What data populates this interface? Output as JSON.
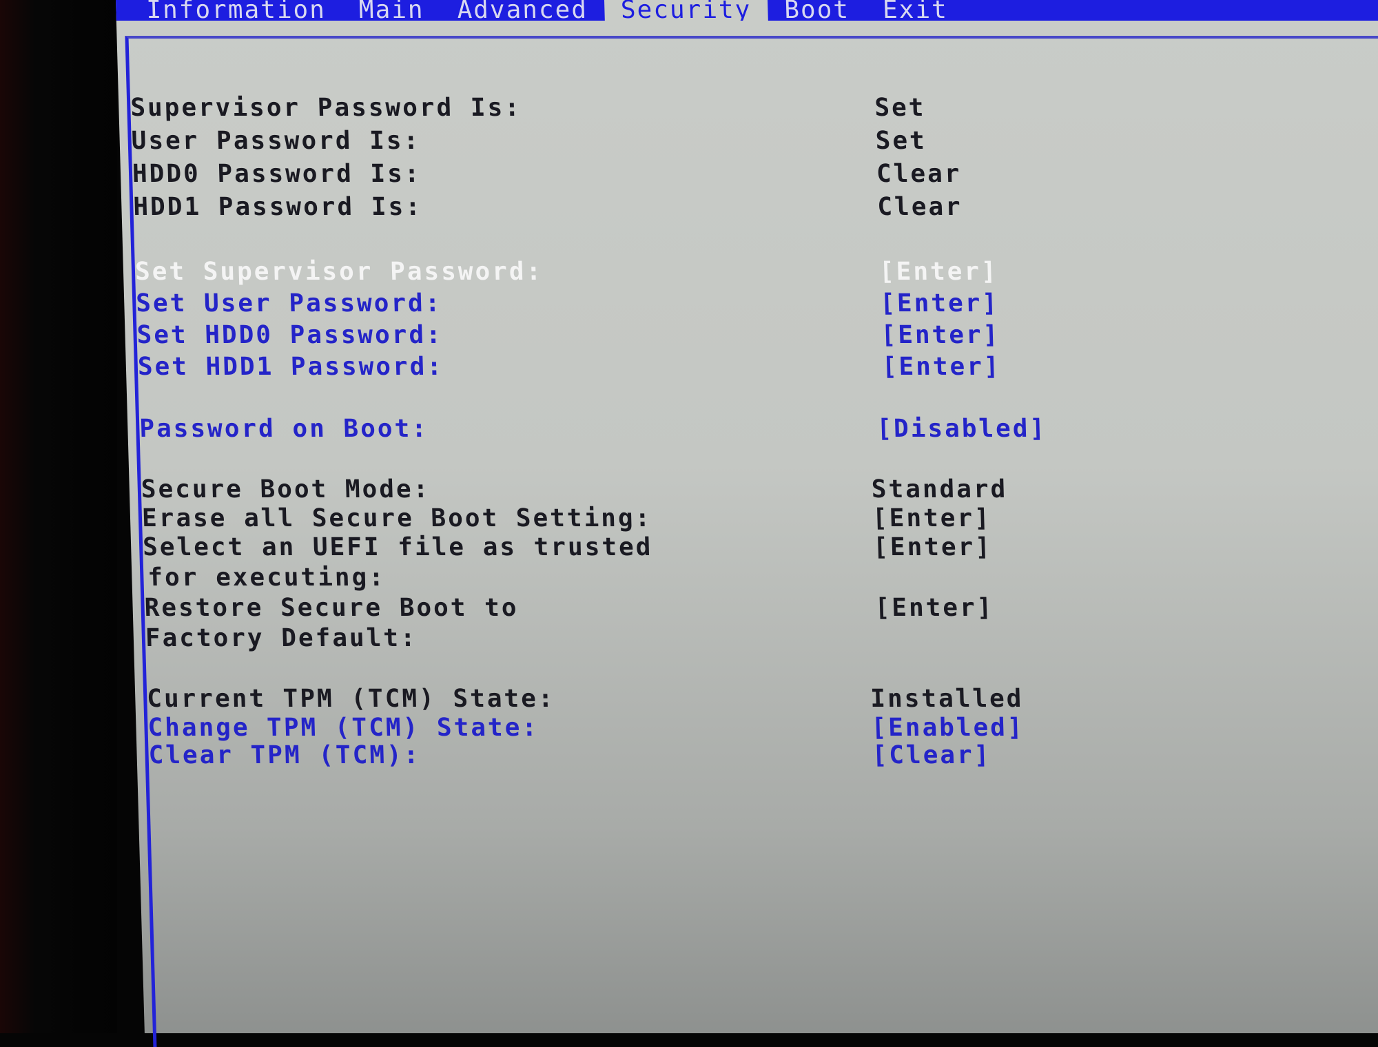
{
  "menu": {
    "tabs": [
      {
        "label": "Information",
        "active": false
      },
      {
        "label": "Main",
        "active": false
      },
      {
        "label": "Advanced",
        "active": false
      },
      {
        "label": "Security",
        "active": true
      },
      {
        "label": "Boot",
        "active": false
      },
      {
        "label": "Exit",
        "active": false
      }
    ]
  },
  "security": {
    "status": [
      {
        "label": "Supervisor Password Is:",
        "value": "Set"
      },
      {
        "label": "User Password Is:",
        "value": "Set"
      },
      {
        "label": "HDD0 Password Is:",
        "value": "Clear"
      },
      {
        "label": "HDD1 Password Is:",
        "value": "Clear"
      }
    ],
    "password_actions": [
      {
        "label": "Set Supervisor Password:",
        "value": "[Enter]",
        "selected": true
      },
      {
        "label": "Set User Password:",
        "value": "[Enter]",
        "selected": false
      },
      {
        "label": "Set HDD0 Password:",
        "value": "[Enter]",
        "selected": false
      },
      {
        "label": "Set HDD1 Password:",
        "value": "[Enter]",
        "selected": false
      }
    ],
    "password_on_boot": {
      "label": "Password on Boot:",
      "value": "[Disabled]"
    },
    "secure_boot": {
      "mode": {
        "label": "Secure Boot Mode:",
        "value": "Standard"
      },
      "erase": {
        "label": "Erase all Secure Boot Setting:",
        "value": "[Enter]"
      },
      "select_uefi": {
        "label_line1": "Select an UEFI file as trusted",
        "label_line2": "for executing:",
        "value": "[Enter]"
      },
      "restore": {
        "label_line1": "Restore Secure Boot to",
        "label_line2": "Factory Default:",
        "value": "[Enter]"
      }
    },
    "tpm": {
      "current": {
        "label": "Current TPM (TCM) State:",
        "value": "Installed"
      },
      "change": {
        "label": "Change TPM (TCM) State:",
        "value": "[Enabled]"
      },
      "clear": {
        "label": "Clear TPM (TCM):",
        "value": "[Clear]"
      }
    }
  },
  "colors": {
    "menubar": "#1d1ee0",
    "background": "#c9ccc8",
    "highlight_text": "#f4f4f4",
    "option_text": "#2424c8",
    "static_text": "#1a1a22"
  }
}
